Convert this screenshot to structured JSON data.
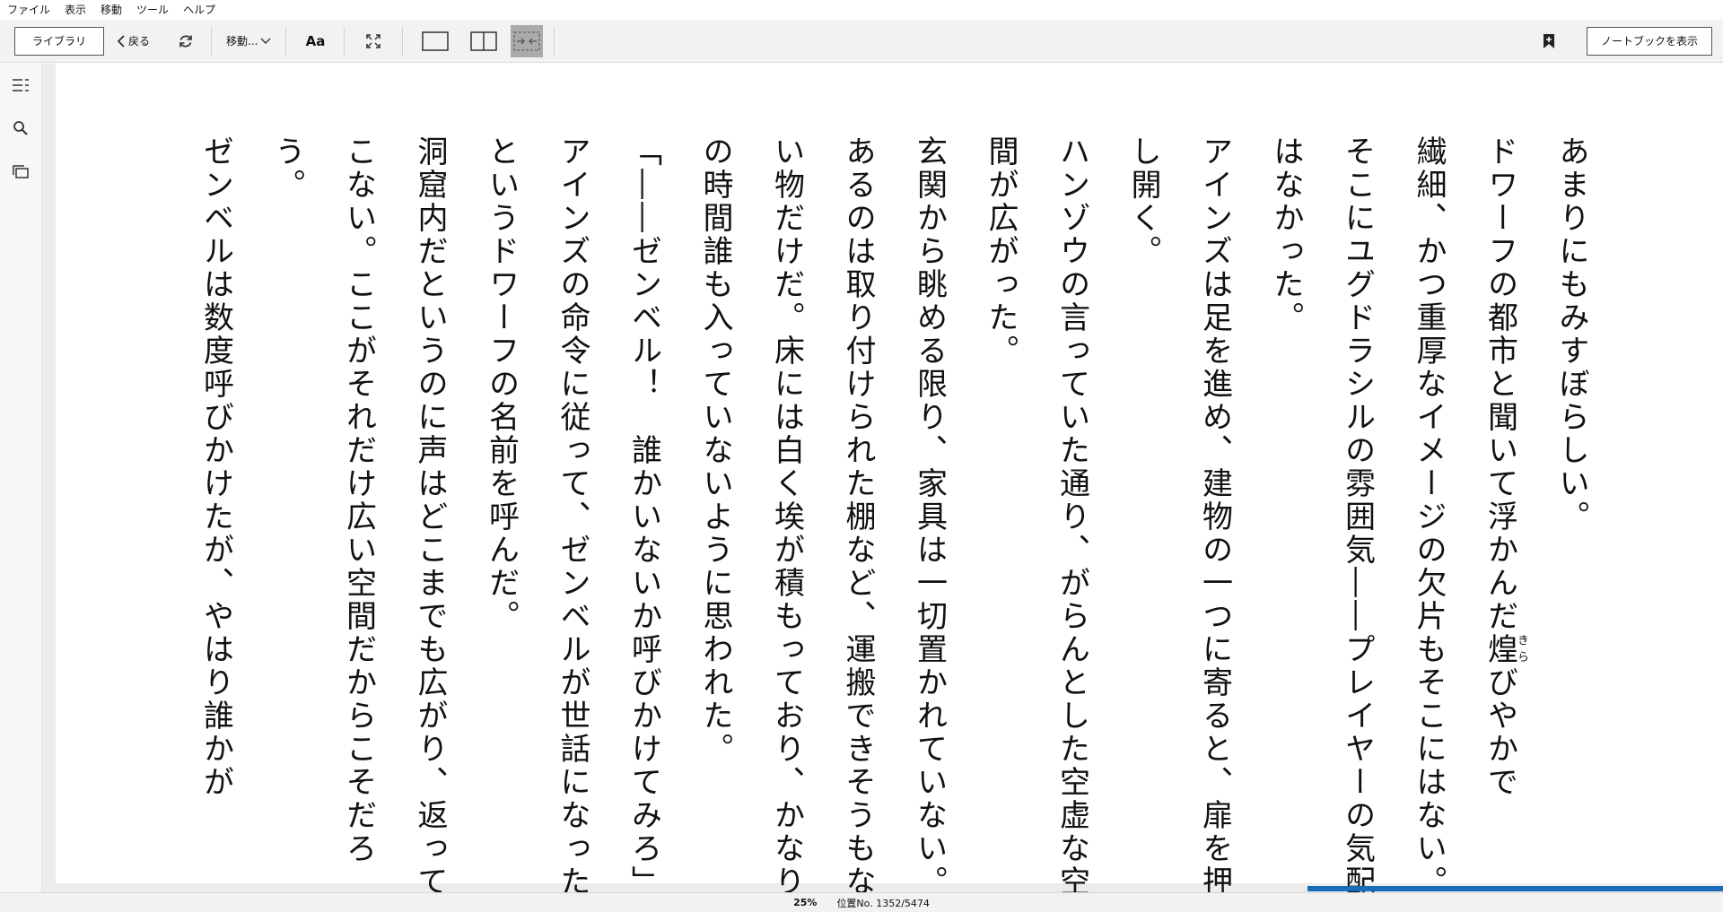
{
  "menu": [
    "ファイル",
    "表示",
    "移動",
    "ツール",
    "ヘルプ"
  ],
  "toolbar": {
    "library_label": "ライブラリ",
    "back_label": "戻る",
    "goto_label": "移動...",
    "font_label": "Aa",
    "notebook_label": "ノートブックを表示"
  },
  "book": {
    "paragraphs": [
      "あまりにもみすぼらしい。",
      "ドワーフの都市と聞いて浮かんだ",
      "繊細、かつ重厚なイメージの欠片もそこにはない。そこにユグドラシルの雰囲気――プレイヤーの気配はなかった。",
      "アインズは足を進め、建物の一つに寄ると、扉を押し開く。",
      "ハンゾウの言っていた通り、がらんとした空虚な空間が広がった。",
      "玄関から眺める限り、家具は一切置かれていない。あるのは取り付けられた棚など、運搬できそうもない物だけだ。床には白く埃が積もっており、かなりの時間誰も入っていないように思われた。",
      "「――ゼンベル！　誰かいないか呼びかけてみろ」",
      "アインズの命令に従って、ゼンベルが世話になったというドワーフの名前を呼んだ。",
      "洞窟内だというのに声はどこまでも広がり、返ってこない。ここがそれだけ広い空間だからこそだろう。",
      "ゼンベルは数度呼びかけたが、やはり誰かが"
    ],
    "ruby_base": "煌",
    "ruby_text": "きら",
    "ruby_after": "びやかで"
  },
  "status": {
    "percent": "25%",
    "location": "位置No. 1352/5474",
    "progress_fraction": 0.25
  },
  "colors": {
    "progress": "#1a6bb8",
    "toolbar_bg": "#f2f2f2"
  }
}
